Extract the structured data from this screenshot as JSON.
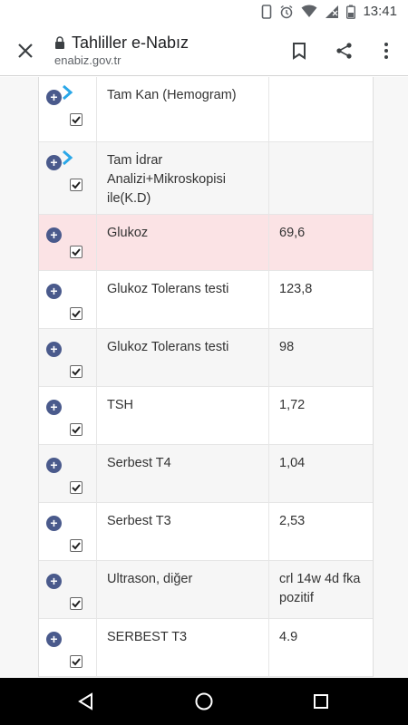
{
  "status_bar": {
    "time": "13:41",
    "icons": [
      "phone-icon",
      "alarm-icon",
      "wifi-icon",
      "signal-icon",
      "battery-icon"
    ]
  },
  "app_bar": {
    "title": "Tahliller e-Nabız",
    "url": "enabiz.gov.tr",
    "icons": [
      "close-icon",
      "lock-icon",
      "bookmark-icon",
      "share-icon",
      "more-icon"
    ]
  },
  "table": {
    "rows": [
      {
        "name": "Tam Kan (Hemogram)",
        "value": ""
      },
      {
        "name": "Tam İdrar Analizi+Mikroskopisi ile(K.D)",
        "value": ""
      },
      {
        "name": "Glukoz",
        "value": "69,6"
      },
      {
        "name": "Glukoz Tolerans testi",
        "value": "123,8"
      },
      {
        "name": "Glukoz Tolerans testi",
        "value": "98"
      },
      {
        "name": "TSH",
        "value": "1,72"
      },
      {
        "name": "Serbest T4",
        "value": "1,04"
      },
      {
        "name": "Serbest T3",
        "value": "2,53"
      },
      {
        "name": "Ultrason, diğer",
        "value": "crl 14w 4d fka pozitif"
      },
      {
        "name": "SERBEST T3",
        "value": "4.9"
      }
    ]
  },
  "colors": {
    "highlight_row": "#fbe3e5",
    "plus_badge": "#4a5a8c",
    "chevron": "#2aa7e8"
  },
  "nav_bar": {
    "icons": [
      "back-icon",
      "home-icon",
      "recents-icon"
    ]
  }
}
